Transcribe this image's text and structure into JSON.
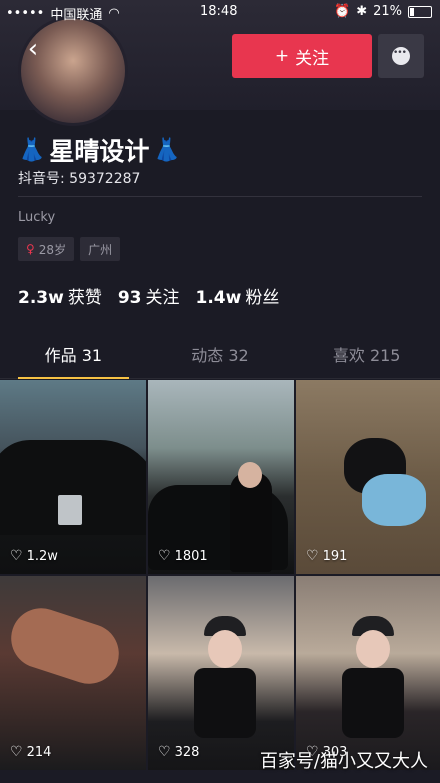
{
  "status_bar": {
    "carrier": "中国联通",
    "time": "18:48",
    "battery": "21%"
  },
  "header": {
    "follow_label": "关注",
    "follow_prefix": "+"
  },
  "profile": {
    "name": "星晴设计",
    "douyin_id": "抖音号: 59372287",
    "bio": "Lucky",
    "tags": [
      "28岁",
      "广州"
    ],
    "stats": [
      {
        "value": "2.3w",
        "label": "获赞"
      },
      {
        "value": "93",
        "label": "关注"
      },
      {
        "value": "1.4w",
        "label": "粉丝"
      }
    ]
  },
  "tabs": [
    {
      "label": "作品 31",
      "active": true
    },
    {
      "label": "动态 32",
      "active": false
    },
    {
      "label": "喜欢 215",
      "active": false
    }
  ],
  "videos": [
    {
      "likes": "1.2w"
    },
    {
      "likes": "1801"
    },
    {
      "likes": "191"
    },
    {
      "likes": "214"
    },
    {
      "likes": "328"
    },
    {
      "likes": "303"
    }
  ],
  "watermark": "百家号/猫小又又大人",
  "colors": {
    "background": "#1b1b25",
    "follow_button": "#e8364f",
    "active_tab_indicator": "#f6c244"
  }
}
